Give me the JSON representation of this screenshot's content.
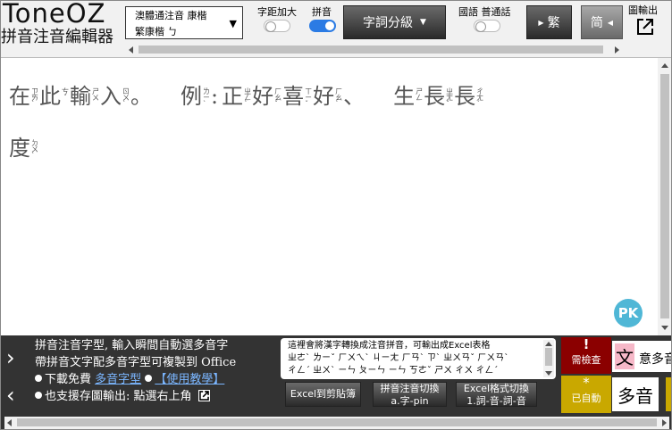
{
  "app": {
    "logo": "ToneOZ",
    "subtitle": "拼音注音編輯器"
  },
  "toolbar": {
    "font_select_line1": "澳體通注音 康楷",
    "font_select_line2": "繁康楷 ㄅ",
    "spacing_label": "字距加大",
    "pinyin_label": "拼音",
    "segment_button": "字詞分級",
    "lang_label": "國語 普通話",
    "traditional_button": "繁",
    "simplified_button": "简",
    "export_label": "圖輸出"
  },
  "editor": {
    "line1": [
      {
        "c": "在",
        "z": [
          "ㄗ",
          "ㄞˋ"
        ]
      },
      {
        "c": "此",
        "z": [
          "ㄘ",
          "ˇ"
        ]
      },
      {
        "c": "輸",
        "z": [
          "ㄕ",
          "ㄨ"
        ]
      },
      {
        "c": "入",
        "z": [
          "ㄖ",
          "ㄨˋ"
        ]
      },
      {
        "p": "。"
      },
      {
        "sp": true
      },
      {
        "c": "例",
        "z": [
          "ㄌ",
          "ㄧˋ"
        ]
      },
      {
        "p": ":"
      },
      {
        "c": "正",
        "z": [
          "ㄓ",
          "ㄥˋ"
        ]
      },
      {
        "c": "好",
        "z": [
          "ㄏ",
          "ㄠˇ"
        ]
      },
      {
        "c": "喜",
        "z": [
          "ㄒ",
          "ㄧˇ"
        ]
      },
      {
        "c": "好",
        "z": [
          "ㄏ",
          "ㄠˋ"
        ]
      },
      {
        "p": "、"
      },
      {
        "sp": true
      },
      {
        "c": "生",
        "z": [
          "ㄕ",
          "ㄥ"
        ]
      },
      {
        "c": "長",
        "z": [
          "ㄓ",
          "ㄤˇ"
        ]
      },
      {
        "c": "長",
        "z": [
          "ㄔ",
          "ㄤˊ"
        ]
      }
    ],
    "line2": [
      {
        "c": "度",
        "z": [
          "ㄉ",
          "ㄨˋ"
        ]
      }
    ]
  },
  "bottom": {
    "info_line1": "拼音注音字型, 輸入瞬間自動選多音字",
    "info_line2": "帶拼音文字配多音字型可複製到 Office",
    "download_prefix": "下載免費",
    "download_link": "多音字型",
    "tutorial_link": "【使用教學】",
    "image_export_text": "也支援存圖輸出: 點選右上角",
    "note_line1": "這裡會將漢字轉換成注音拼音，可輸出成Excel表格",
    "note_line2": "ㄓㄜˋ ㄌㄧˇ ㄏㄨㄟˋ ㄐㄧㄤ ㄏㄢˋ ㄗˋ ㄓㄨㄢˇ ㄏㄨㄢˋ",
    "note_line3": "ㄔㄥˊ ㄓㄨˋ ㄧㄣ ㄆㄧㄣ ㄧㄣ ㄎㄜˇ ㄕㄨ ㄔㄨ ㄔㄥˊ",
    "excel_clip": "Excel到剪貼簿",
    "pinyin_switch_line1": "拼音注音切換",
    "pinyin_switch_line2": "a.字-pin",
    "excel_format_line1": "Excel格式切換",
    "excel_format_line2": "1.詞-音-詞-音",
    "check_mark": "!",
    "check_label": "需檢查",
    "auto_mark": "*",
    "auto_label": "已自動",
    "check_sample_char": "文",
    "check_sample_rest": "意多音",
    "auto_sample": "多音"
  },
  "colors": {
    "toggle_on": "#2b7be4",
    "check_bg": "#8b0000",
    "auto_bg": "#c9a800",
    "pk_badge": "#4fb7d6"
  }
}
